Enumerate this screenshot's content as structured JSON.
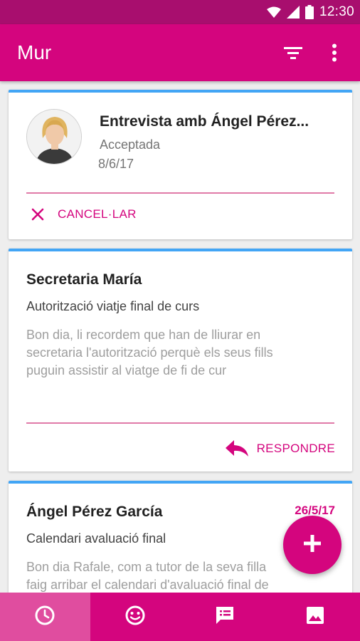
{
  "status_bar": {
    "time": "12:30",
    "icons": [
      "wifi-icon",
      "signal-icon",
      "battery-icon"
    ]
  },
  "app_bar": {
    "title": "Mur",
    "actions": [
      "filter-icon",
      "more-vert-icon"
    ]
  },
  "cards": [
    {
      "type": "interview",
      "title": "Entrevista amb Ángel Pérez...",
      "status": "Acceptada",
      "date": "8/6/17",
      "action_label": "CANCEL·LAR"
    },
    {
      "type": "message",
      "from": "Secretaria María",
      "subject": "Autorització viatje final de curs",
      "body_lines": [
        "Bon dia, li recordem que han de lliurar en",
        "secretaria l'autorització perquè els seus fills",
        "puguin assistir al viatge de fi de cur"
      ],
      "action_label": "RESPONDRE"
    },
    {
      "type": "message",
      "from": "Ángel Pérez García",
      "date": "26/5/17",
      "subject": "Calendari avaluació final",
      "body_lines": [
        "Bon dia Rafale, com a tutor de la seva filla",
        "faig arribar el calendari d'avaluació final de"
      ]
    }
  ],
  "fab": {
    "icon": "add-icon"
  },
  "bottom_nav": {
    "items": [
      {
        "icon": "clock-icon",
        "active": true
      },
      {
        "icon": "smiley-icon",
        "active": false
      },
      {
        "icon": "message-icon",
        "active": false
      },
      {
        "icon": "image-icon",
        "active": false
      }
    ]
  },
  "colors": {
    "primary": "#d4057e",
    "primary_dark": "#a80e6e",
    "card_accent": "#42a5f5",
    "background": "#eeeeee"
  }
}
